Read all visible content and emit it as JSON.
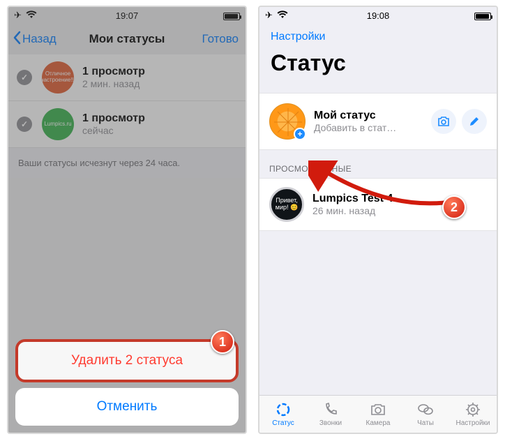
{
  "left": {
    "statusbar_time": "19:07",
    "nav": {
      "back": "Назад",
      "title": "Мои статусы",
      "done": "Готово"
    },
    "rows": [
      {
        "thumb_text": "Отличное настроение!!!",
        "title": "1 просмотр",
        "time": "2 мин. назад"
      },
      {
        "thumb_text": "Lumpics.ru",
        "title": "1 просмотр",
        "time": "сейчас"
      }
    ],
    "footnote": "Ваши статусы исчезнут через 24 часа.",
    "sheet": {
      "delete": "Удалить 2 статуса",
      "cancel": "Отменить"
    },
    "callout1": "1"
  },
  "right": {
    "statusbar_time": "19:08",
    "nav_back": "Настройки",
    "big_title": "Статус",
    "my_status": {
      "title": "Мой статус",
      "subtitle": "Добавить в стат…"
    },
    "section_header": "ПРОСМОТРЕННЫЕ",
    "viewed": {
      "thumb_text": "Привет, мир! 😊",
      "title": "Lumpics Test 4",
      "time": "26 мин. назад"
    },
    "tabs": {
      "status": "Статус",
      "calls": "Звонки",
      "camera": "Камера",
      "chats": "Чаты",
      "settings": "Настройки"
    },
    "callout2": "2"
  }
}
